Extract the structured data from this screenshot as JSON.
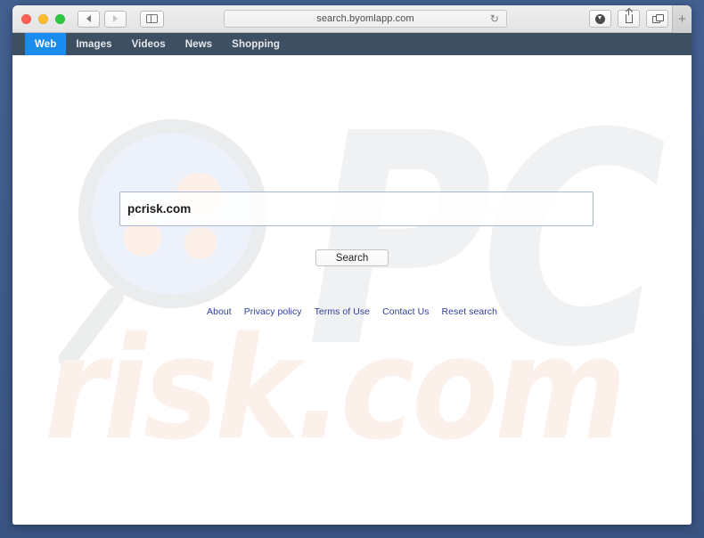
{
  "browser": {
    "window_controls": {
      "close_label": "",
      "minimize_label": "",
      "zoom_label": ""
    },
    "back_label": "",
    "forward_label": "",
    "sidebar_label": "",
    "url": "search.byomlapp.com",
    "reload_glyph": "↻",
    "download_label": "",
    "share_label": "",
    "tab_overview_label": "",
    "new_tab_label": "+"
  },
  "sitenav": {
    "items": [
      {
        "label": "Web",
        "active": true
      },
      {
        "label": "Images",
        "active": false
      },
      {
        "label": "Videos",
        "active": false
      },
      {
        "label": "News",
        "active": false
      },
      {
        "label": "Shopping",
        "active": false
      }
    ]
  },
  "search": {
    "query": "pcrisk.com",
    "placeholder": "",
    "button_label": "Search"
  },
  "watermark": {
    "top_text": "PC",
    "bottom_text": "risk.com"
  },
  "footer": {
    "links": [
      {
        "label": "About"
      },
      {
        "label": "Privacy policy"
      },
      {
        "label": "Terms of Use"
      },
      {
        "label": "Contact Us"
      },
      {
        "label": "Reset search"
      }
    ]
  },
  "colors": {
    "desktop": "#3f5e8f",
    "nav_bar": "#3e4f62",
    "active_tab": "#1a8cf0",
    "link": "#31409c",
    "watermark_gray": "#f0f1f2",
    "watermark_peach": "#fbf1ea",
    "lens_blue": "#edf1fa"
  }
}
